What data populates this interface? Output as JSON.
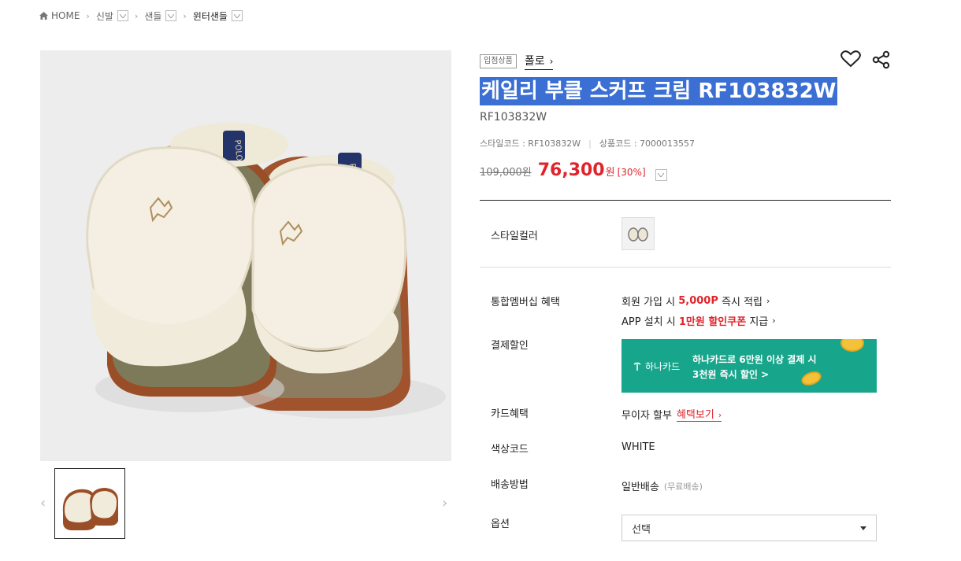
{
  "breadcrumb": {
    "home": "HOME",
    "items": [
      "신발",
      "샌들",
      "윈터샌들"
    ]
  },
  "product": {
    "tag": "입점상품",
    "brand": "폴로",
    "title": "케일리 부클 스커프 크림 RF103832W",
    "model": "RF103832W",
    "style_code_label": "스타일코드 : RF103832W",
    "product_code_label": "상품코드 : 7000013557",
    "price_original": "109,000원",
    "price_now": "76,300",
    "price_unit": "원",
    "discount": "[30%]"
  },
  "details": {
    "style_color_label": "스타일컬러",
    "membership_label": "통합멤버십 혜택",
    "membership_line1_pre": "회원 가입 시",
    "membership_line1_hl": "5,000P",
    "membership_line1_post": "즉시 적립",
    "membership_line2_pre": "APP 설치 시",
    "membership_line2_hl": "1만원 할인쿠폰",
    "membership_line2_post": "지급",
    "payment_label": "결제할인",
    "banner_logo": "하나카드",
    "banner_line1": "하나카드로 6만원 이상 결제 시",
    "banner_line2": "3천원 즉시 할인 >",
    "card_label": "카드혜택",
    "card_value": "무이자 할부",
    "card_link": "혜택보기",
    "color_code_label": "색상코드",
    "color_code_value": "WHITE",
    "shipping_label": "배송방법",
    "shipping_value": "일반배송",
    "shipping_note": "(무료배송)",
    "option_label": "옵션",
    "option_value": "선택"
  },
  "colors": {
    "accent_red": "#e0242b",
    "title_highlight": "#3b6fd4",
    "banner_green": "#17a58b"
  }
}
